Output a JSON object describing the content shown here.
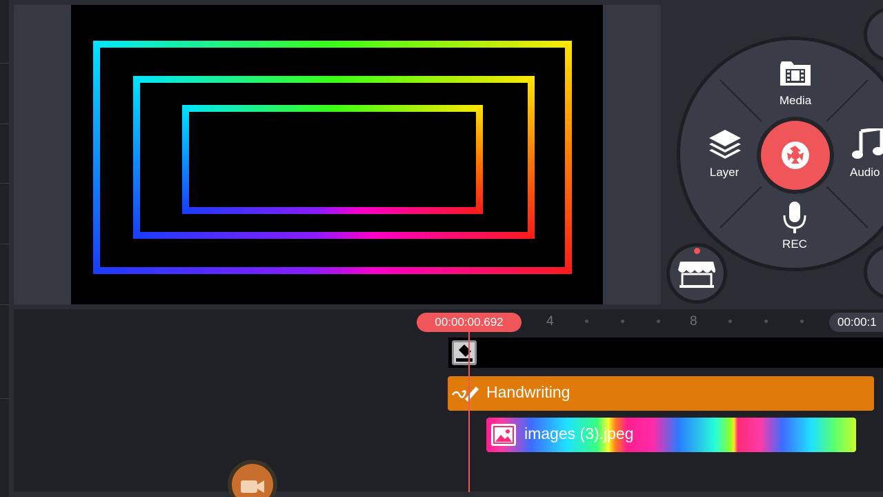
{
  "preview": {
    "colors": {
      "cyan": "#00e5ff",
      "green": "#39ff14",
      "yellow": "#ffe600",
      "orange": "#ff7a00",
      "red": "#ff1a1a",
      "magenta": "#ff00c8",
      "purple": "#8a1cff",
      "blue": "#1a3cff"
    }
  },
  "radial_menu": {
    "media_label": "Media",
    "layer_label": "Layer",
    "audio_label": "Audio",
    "rec_label": "REC",
    "accent": "#f0555a"
  },
  "timeline": {
    "playhead_time": "00:00:00.692",
    "end_time": "00:00:1",
    "ruler_labels": [
      "4",
      "8"
    ],
    "tracks": {
      "handwriting_label": "Handwriting",
      "image_label": "images (3).jpeg"
    },
    "colors": {
      "playhead": "#f0555a",
      "handwriting_track": "#e07a0a"
    }
  }
}
